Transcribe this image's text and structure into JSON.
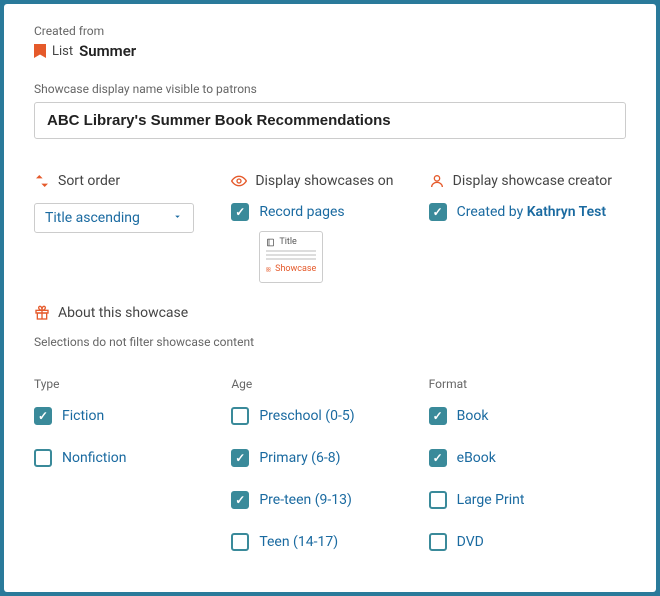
{
  "createdFromLabel": "Created from",
  "listPrefix": "List",
  "listName": "Summer",
  "displayNameLabel": "Showcase display name visible to patrons",
  "displayNameValue": "ABC Library's Summer Book Recommendations",
  "sortOrder": {
    "title": "Sort order",
    "value": "Title ascending"
  },
  "displayOn": {
    "title": "Display showcases on",
    "recordPages": "Record pages",
    "preview": {
      "title": "Title",
      "showcase": "Showcase"
    }
  },
  "creator": {
    "title": "Display showcase creator",
    "prefix": "Created by ",
    "name": "Kathryn Test"
  },
  "about": {
    "title": "About this showcase",
    "note": "Selections do not filter showcase content"
  },
  "headers": {
    "type": "Type",
    "age": "Age",
    "format": "Format"
  },
  "type": {
    "fiction": "Fiction",
    "nonfiction": "Nonfiction"
  },
  "age": {
    "preschool": "Preschool (0-5)",
    "primary": "Primary (6-8)",
    "preteen": "Pre-teen (9-13)",
    "teen": "Teen (14-17)"
  },
  "format": {
    "book": "Book",
    "ebook": "eBook",
    "largeprint": "Large Print",
    "dvd": "DVD"
  }
}
